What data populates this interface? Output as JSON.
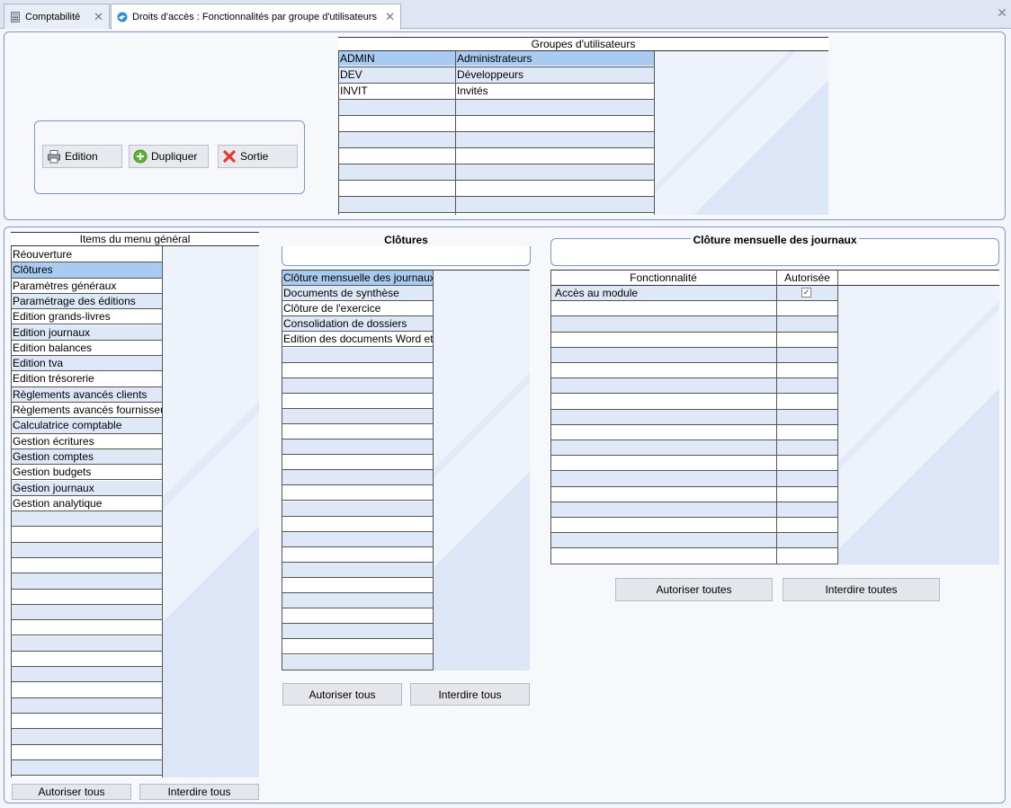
{
  "tabs": [
    {
      "label": "Comptabilité",
      "active": false
    },
    {
      "label": "Droits d'accès : Fonctionnalités par groupe d'utilisateurs",
      "active": true
    }
  ],
  "toolbar": {
    "edition_label": "Edition",
    "dupliquer_label": "Dupliquer",
    "sortie_label": "Sortie"
  },
  "groups": {
    "title": "Groupes d'utilisateurs",
    "rows": [
      {
        "code": "ADMIN",
        "name": "Administrateurs",
        "selected": true
      },
      {
        "code": "DEV",
        "name": "Développeurs",
        "selected": false
      },
      {
        "code": "INVIT",
        "name": "Invités",
        "selected": false
      }
    ]
  },
  "menu_items": {
    "title": "Items du menu général",
    "items": [
      "Réouverture",
      "Clôtures",
      "Paramètres généraux",
      "Paramétrage des éditions",
      "Edition grands-livres",
      "Edition journaux",
      "Edition balances",
      "Edition tva",
      "Edition trésorerie",
      "Règlements avancés clients",
      "Règlements avancés fournisseurs",
      "Calculatrice comptable",
      "Gestion écritures",
      "Gestion comptes",
      "Gestion budgets",
      "Gestion journaux",
      "Gestion analytique"
    ],
    "selected_index": 1,
    "autoriser_label": "Autoriser tous",
    "interdire_label": "Interdire tous"
  },
  "clotures": {
    "title": "Clôtures",
    "items": [
      "Clôture mensuelle des journaux",
      "Documents de synthèse",
      "Clôture de l'exercice",
      "Consolidation de dossiers",
      "Edition des documents Word et Excel"
    ],
    "selected_index": 0,
    "autoriser_label": "Autoriser tous",
    "interdire_label": "Interdire tous"
  },
  "fonctionnalites": {
    "title": "Clôture mensuelle des journaux",
    "col_fonctionnalite": "Fonctionnalité",
    "col_autorisee": "Autorisée",
    "rows": [
      {
        "label": "Accès au module",
        "checked": true
      }
    ],
    "autoriser_label": "Autoriser toutes",
    "interdire_label": "Interdire toutes"
  }
}
